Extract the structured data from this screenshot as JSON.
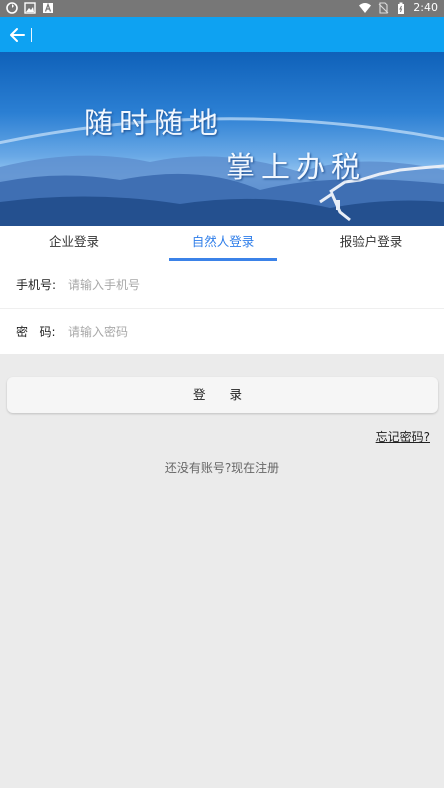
{
  "status_bar": {
    "time": "2:40",
    "left_icons": [
      "sync-icon",
      "image-icon",
      "font-icon"
    ],
    "right_icons": [
      "wifi-icon",
      "no-sim-icon",
      "battery-icon"
    ]
  },
  "app_bar": {
    "back_icon": "arrow-left-icon",
    "color": "#0ea2f2"
  },
  "banner": {
    "line1": "随时随地",
    "line2": "掌上办税"
  },
  "tabs": [
    {
      "label": "企业登录",
      "active": false
    },
    {
      "label": "自然人登录",
      "active": true
    },
    {
      "label": "报验户登录",
      "active": false
    }
  ],
  "form": {
    "phone_label": "手机号:",
    "phone_placeholder": "请输入手机号",
    "password_label": "密   码:",
    "password_placeholder": "请输入密码"
  },
  "login_button": "登 录",
  "forgot_password": "忘记密码?",
  "register_text": "还没有账号?现在注册",
  "colors": {
    "accent": "#2f7ee9",
    "background": "#ebebeb"
  }
}
